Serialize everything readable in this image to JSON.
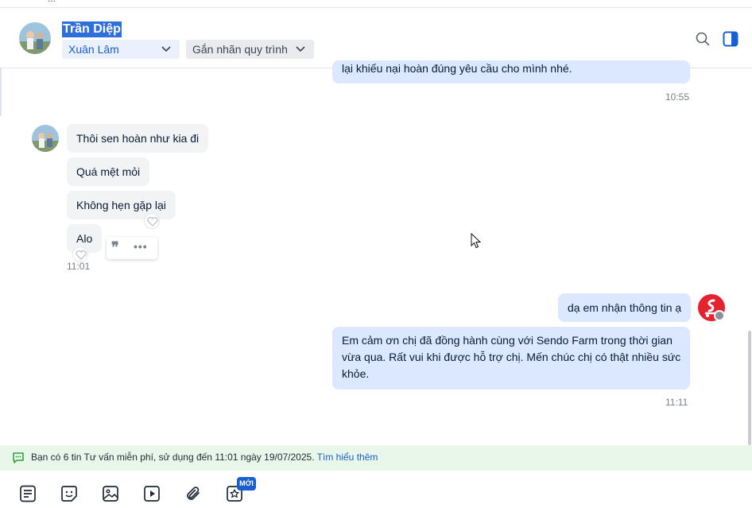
{
  "top_strip_text": "...",
  "header": {
    "contact_name": "Trần Diệp",
    "assignee": "Xuân Lâm",
    "tag_placeholder": "Gắn nhãn quy trình"
  },
  "messages": {
    "out_partial": "lại khiếu nại hoàn đúng yêu cầu cho mình nhé.",
    "time_1": "10:55",
    "in_1": "Thôi sen hoàn như kia đi",
    "in_2": "Quá mệt mỏi",
    "in_3": "Không hẹn gặp lại",
    "in_4": "Alo",
    "time_2": "11:01",
    "out_1": "dạ em nhận thông tin ạ",
    "out_2_line1": "Em cảm ơn chị đã đồng hành cùng với Sendo Farm trong thời gian",
    "out_2_line2": "vừa qua. Rất vui khi được hỗ trợ chị. Mến chúc chị có thật nhiều sức",
    "out_2_line3": "khỏe.",
    "time_3": "11:11"
  },
  "notice": {
    "text": "Bạn có 6 tin Tư vấn miễn phí, sử dụng đến 11:01 ngày 19/07/2025.",
    "link": "Tìm hiểu thêm"
  },
  "toolbar": {
    "new_badge": "MỚI"
  },
  "colors": {
    "accent": "#1a5fd1",
    "bubble_out": "#dbe8ff",
    "bubble_in": "#f2f3f5",
    "notice_bg": "#e8f7e9",
    "sendo_red": "#e5232f"
  }
}
